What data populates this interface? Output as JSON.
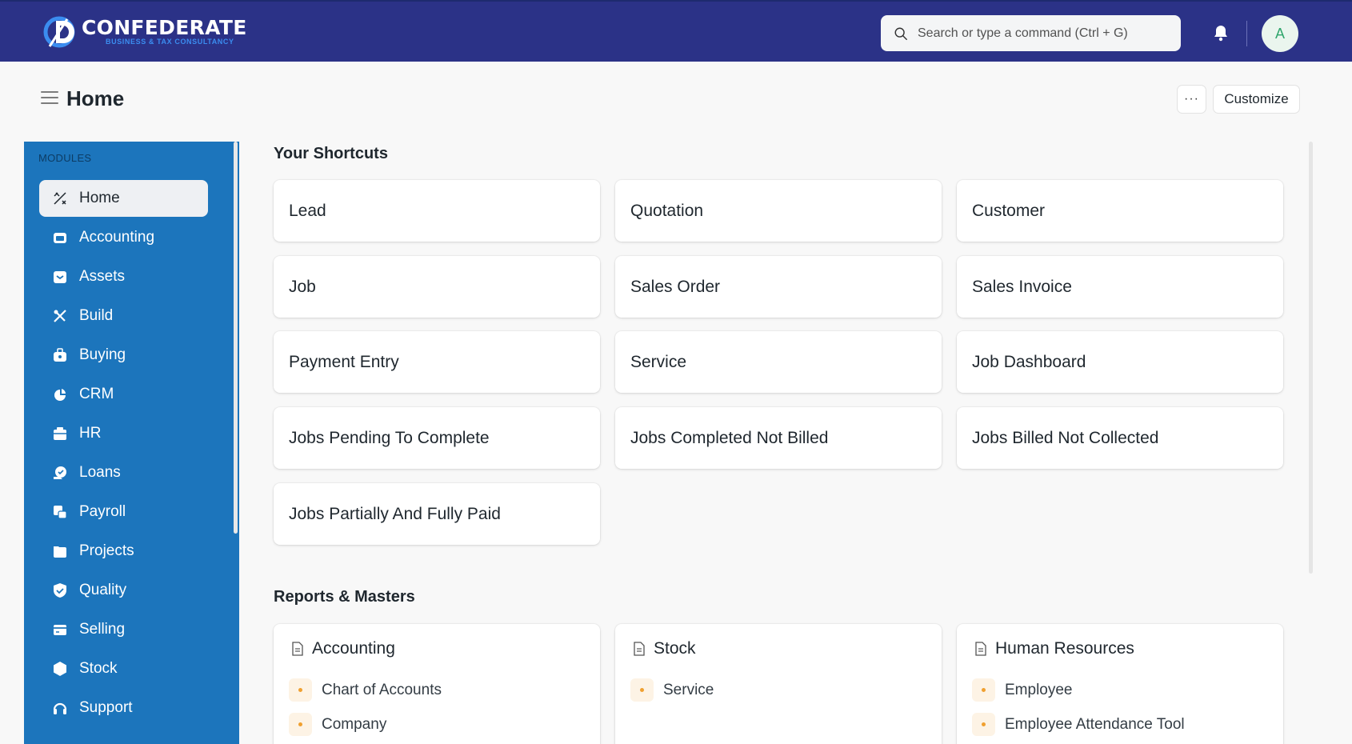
{
  "navbar": {
    "logo_name": "CONFEDERATE",
    "logo_tagline": "BUSINESS & TAX CONSULTANCY",
    "search_placeholder": "Search or type a command (Ctrl + G)",
    "avatar_initial": "A"
  },
  "page": {
    "title": "Home",
    "more_label": "···",
    "customize_label": "Customize"
  },
  "sidebar": {
    "section_label": "MODULES",
    "items": [
      {
        "label": "Home",
        "icon": "tools-icon"
      },
      {
        "label": "Accounting",
        "icon": "accounting-icon"
      },
      {
        "label": "Assets",
        "icon": "assets-icon"
      },
      {
        "label": "Build",
        "icon": "build-icon"
      },
      {
        "label": "Buying",
        "icon": "buying-icon"
      },
      {
        "label": "CRM",
        "icon": "crm-icon"
      },
      {
        "label": "HR",
        "icon": "hr-icon"
      },
      {
        "label": "Loans",
        "icon": "loans-icon"
      },
      {
        "label": "Payroll",
        "icon": "payroll-icon"
      },
      {
        "label": "Projects",
        "icon": "projects-icon"
      },
      {
        "label": "Quality",
        "icon": "quality-icon"
      },
      {
        "label": "Selling",
        "icon": "selling-icon"
      },
      {
        "label": "Stock",
        "icon": "stock-icon"
      },
      {
        "label": "Support",
        "icon": "support-icon"
      }
    ]
  },
  "shortcuts": {
    "title": "Your Shortcuts",
    "items": [
      "Lead",
      "Quotation",
      "Customer",
      "Job",
      "Sales Order",
      "Sales Invoice",
      "Payment Entry",
      "Service",
      "Job Dashboard",
      "Jobs Pending To Complete",
      "Jobs Completed Not Billed",
      "Jobs Billed Not Collected",
      "Jobs Partially And Fully Paid"
    ]
  },
  "reports": {
    "title": "Reports & Masters",
    "cards": [
      {
        "title": "Accounting",
        "links": [
          "Chart of Accounts",
          "Company"
        ]
      },
      {
        "title": "Stock",
        "links": [
          "Service"
        ]
      },
      {
        "title": "Human Resources",
        "links": [
          "Employee",
          "Employee Attendance Tool"
        ]
      }
    ]
  },
  "colors": {
    "navbar": "#2b3287",
    "sidebar": "#1c75bc",
    "accent_dot": "#f0a030",
    "avatar_text": "#30a66d"
  }
}
